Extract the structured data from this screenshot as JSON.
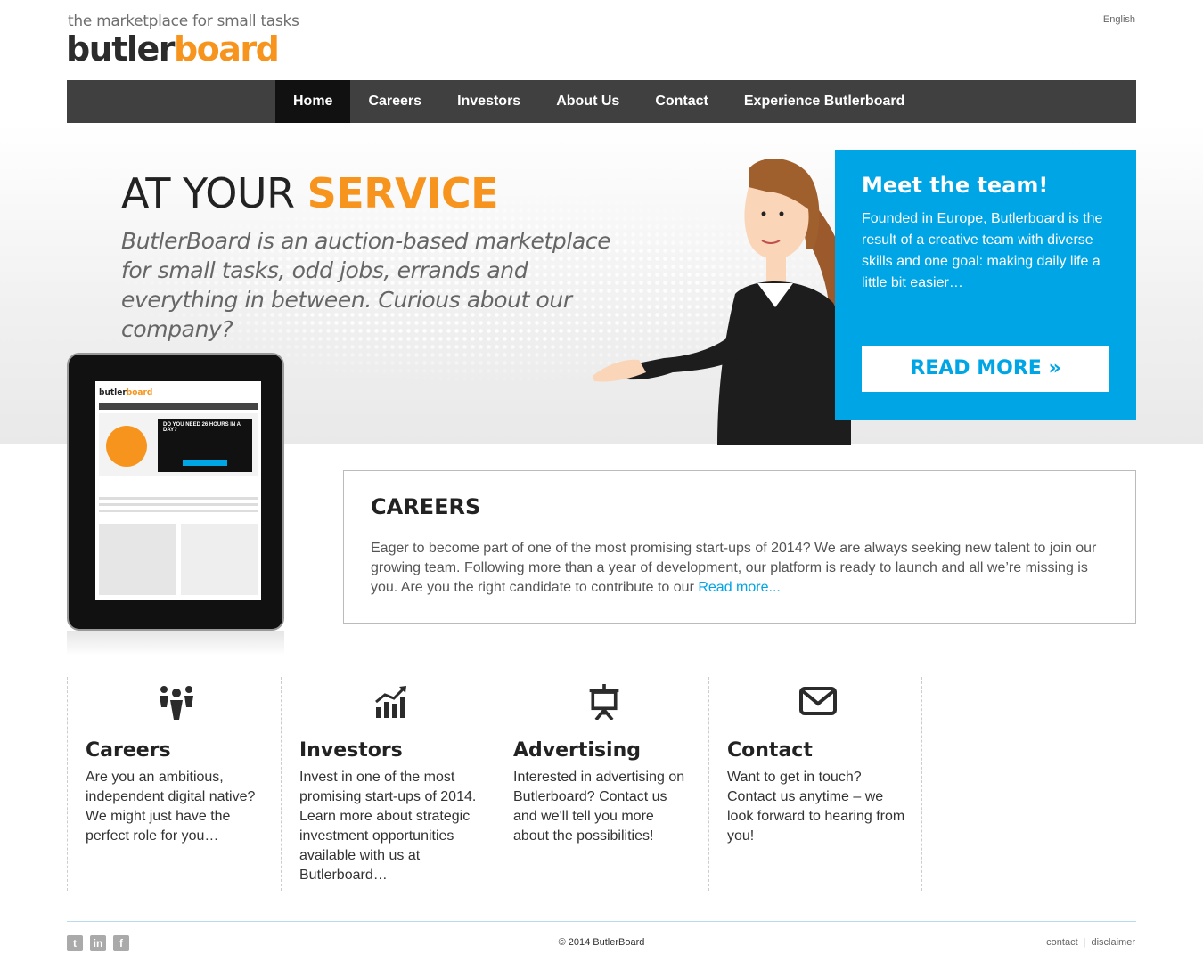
{
  "header": {
    "tagline": "the marketplace for small tasks",
    "logo_part1": "butler",
    "logo_part2": "board",
    "language": "English"
  },
  "nav": {
    "items": [
      "Home",
      "Careers",
      "Investors",
      "About Us",
      "Contact",
      "Experience Butlerboard"
    ],
    "active": "Home"
  },
  "hero": {
    "title_plain": "AT YOUR ",
    "title_accent": "SERVICE",
    "text": "ButlerBoard is an auction-based marketplace for small tasks, odd jobs, errands and everything in between. Curious about our company?"
  },
  "team": {
    "title": "Meet the team!",
    "text": "Founded in Europe, Butlerboard is the result of a creative team with diverse skills and one goal: making daily life a little bit easier…",
    "button": "READ MORE »"
  },
  "tablet": {
    "logo_part1": "butler",
    "logo_part2": "board",
    "box_title": "DO YOU NEED 26 HOURS IN A DAY?"
  },
  "careers": {
    "title": "CAREERS",
    "text": "Eager to become part of one of the most promising start-ups of 2014? We are always seeking new talent to join our growing team. Following more than a year of development, our platform is ready to launch and all we’re missing is you. Are you the right candidate to contribute to our ",
    "link": "Read more..."
  },
  "features": [
    {
      "icon": "people-icon",
      "title": "Careers",
      "text": "Are you an ambitious, independent digital native? We might just have the perfect role for you…"
    },
    {
      "icon": "chart-icon",
      "title": "Investors",
      "text": "Invest in one of the most promising start-ups of 2014. Learn more about strategic investment opportunities available with us at Butlerboard…"
    },
    {
      "icon": "presentation-icon",
      "title": "Advertising",
      "text": "Interested in advertising on Butlerboard? Contact us and we'll tell you more about the possibilities!"
    },
    {
      "icon": "envelope-icon",
      "title": "Contact",
      "text": "Want to get in touch? Contact us anytime – we look forward to hearing from you!"
    }
  ],
  "footer": {
    "social": [
      "twitter-icon",
      "linkedin-icon",
      "facebook-icon"
    ],
    "copyright": "© 2014 ButlerBoard",
    "links": [
      "contact",
      "disclaimer"
    ]
  },
  "colors": {
    "accent_orange": "#f7941d",
    "accent_blue": "#00a5e5",
    "nav_bg": "#404040"
  }
}
